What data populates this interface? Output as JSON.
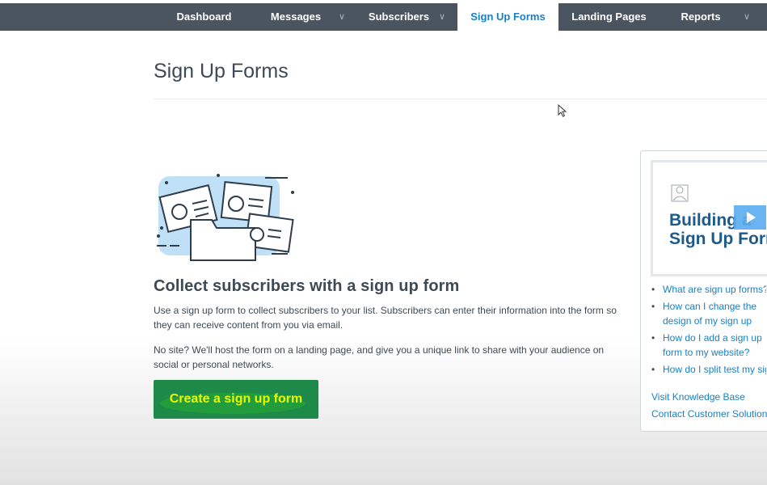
{
  "nav": {
    "tabs": [
      {
        "label": "Dashboard"
      },
      {
        "label": "Messages"
      },
      {
        "label": "Subscribers"
      },
      {
        "label": "Sign Up Forms"
      },
      {
        "label": "Landing Pages"
      },
      {
        "label": "Reports"
      }
    ]
  },
  "page": {
    "title": "Sign Up Forms",
    "headline": "Collect subscribers with a sign up form",
    "paragraph1": "Use a sign up form to collect subscribers to your list. Subscribers can enter their information into the form so they can receive content from you via email.",
    "paragraph2": "No site? We'll host the form on a landing page, and give you a unique link to share with your audience on social or personal networks.",
    "cta_label": "Create a sign up form"
  },
  "sidebar": {
    "video_title_line1": "Building a",
    "video_title_line2": "Sign Up Form",
    "links": [
      "What are sign up forms?",
      "How can I change the design of my sign up form?",
      "How do I add a sign up form to my website?",
      "How do I split test my sign up form?"
    ],
    "knowledge_base": "Visit Knowledge Base",
    "contact": "Contact Customer Solutions"
  },
  "colors": {
    "nav_bg": "#4a5560",
    "active_tab_text": "#1a7fc1",
    "cta_bg": "#1e8a4a",
    "cta_text": "#e9f700",
    "link": "#1a7fc1"
  }
}
